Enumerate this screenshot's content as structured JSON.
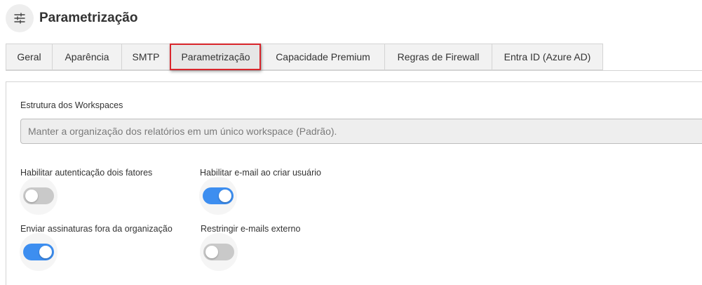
{
  "header": {
    "icon": "sliders-icon",
    "title": "Parametrização"
  },
  "tabs": [
    {
      "label": "Geral",
      "active": false
    },
    {
      "label": "Aparência",
      "active": false
    },
    {
      "label": "SMTP",
      "active": false
    },
    {
      "label": "Parametrização",
      "active": true
    },
    {
      "label": "Capacidade Premium",
      "active": false
    },
    {
      "label": "Regras de Firewall",
      "active": false
    },
    {
      "label": "Entra ID (Azure AD)",
      "active": false
    }
  ],
  "form": {
    "workspace_structure": {
      "label": "Estrutura dos Workspaces",
      "value": "Manter a organização dos relatórios em um único workspace (Padrão)."
    },
    "toggles": {
      "two_factor": {
        "label": "Habilitar autenticação dois fatores",
        "enabled": false
      },
      "email_on_create": {
        "label": "Habilitar e-mail ao criar usuário",
        "enabled": true
      },
      "external_signatures": {
        "label": "Enviar assinaturas fora da organização",
        "enabled": true
      },
      "restrict_external_emails": {
        "label": "Restringir e-mails externo",
        "enabled": false
      }
    }
  },
  "colors": {
    "toggle_on": "#3d8ef0",
    "toggle_off": "#c9c9c9",
    "active_tab_highlight": "#d9262c"
  }
}
